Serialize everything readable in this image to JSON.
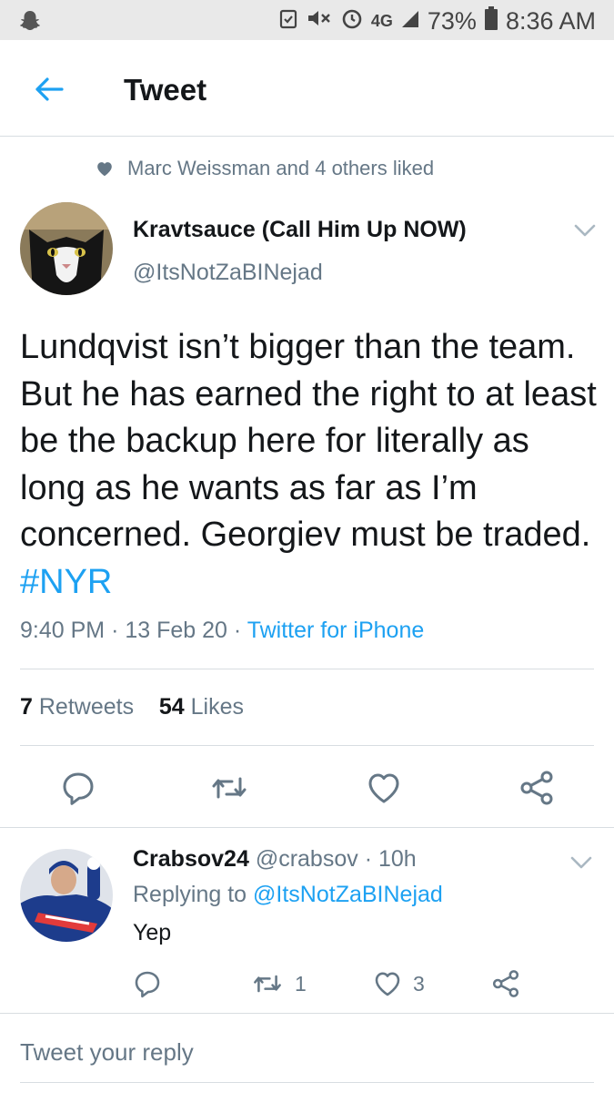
{
  "status_bar": {
    "network": "4G",
    "battery": "73%",
    "time": "8:36 AM"
  },
  "header": {
    "title": "Tweet"
  },
  "social_context": "Marc Weissman and 4 others liked",
  "tweet": {
    "author_name": "Kravtsauce (Call Him Up NOW)",
    "author_handle": "@ItsNotZaBINejad",
    "text": "Lundqvist isn’t bigger than the team. But he has earned the right to at least be the backup here for literally as long as he wants as far as I’m concerned. Georgiev must be traded. ",
    "hashtag": "#NYR",
    "time": "9:40 PM",
    "date": "13 Feb 20",
    "source": "Twitter for iPhone",
    "retweets_count": "7",
    "retweets_label": "Retweets",
    "likes_count": "54",
    "likes_label": "Likes"
  },
  "reply": {
    "author_name": "Crabsov24",
    "author_handle": "@crabsov",
    "age": "10h",
    "replying_prefix": "Replying to",
    "replying_to": "@ItsNotZaBINejad",
    "text": "Yep",
    "retweets": "1",
    "likes": "3"
  },
  "compose": {
    "placeholder": "Tweet your reply"
  },
  "colors": {
    "accent": "#1da1f2",
    "text": "#14171a",
    "secondary": "#657786",
    "divider": "#d8dde1"
  },
  "icons": {
    "back": "arrow-left-icon",
    "liked": "heart-filled-icon",
    "reply": "speech-bubble-icon",
    "retweet": "retweet-icon",
    "like": "heart-icon",
    "share": "share-icon",
    "menu": "chevron-down-icon"
  }
}
